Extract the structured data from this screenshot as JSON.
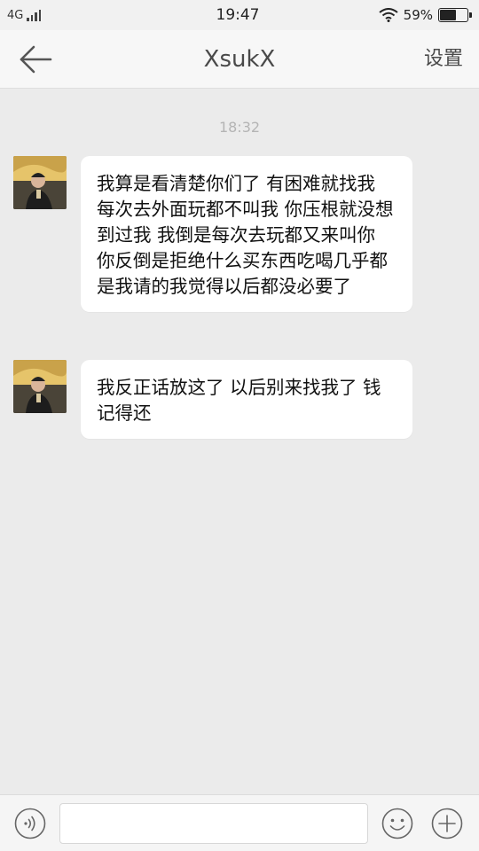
{
  "status_bar": {
    "network": "4G",
    "time": "19:47",
    "battery_percent_text": "59%",
    "battery_level": 0.59,
    "icons": [
      "signal-icon",
      "wifi-icon",
      "battery-icon"
    ]
  },
  "nav": {
    "title": "XsukX",
    "settings_label": "设置",
    "back_icon": "back-arrow-icon"
  },
  "chat": {
    "timestamp": "18:32",
    "messages": [
      {
        "sender": "XsukX",
        "text": "我算是看清楚你们了  有困难就找我  每次去外面玩都不叫我 你压根就没想到过我  我倒是每次去玩都又来叫你 你反倒是拒绝什么买东西吃喝几乎都是我请的我觉得以后都没必要了"
      },
      {
        "sender": "XsukX",
        "text": "我反正话放这了 以后别来找我了  钱记得还"
      }
    ]
  },
  "input_bar": {
    "value": "",
    "placeholder": "",
    "icons": [
      "voice-icon",
      "emoji-icon",
      "plus-icon"
    ]
  },
  "colors": {
    "background": "#ebebeb",
    "bubble": "#ffffff",
    "header": "#f7f7f7"
  }
}
